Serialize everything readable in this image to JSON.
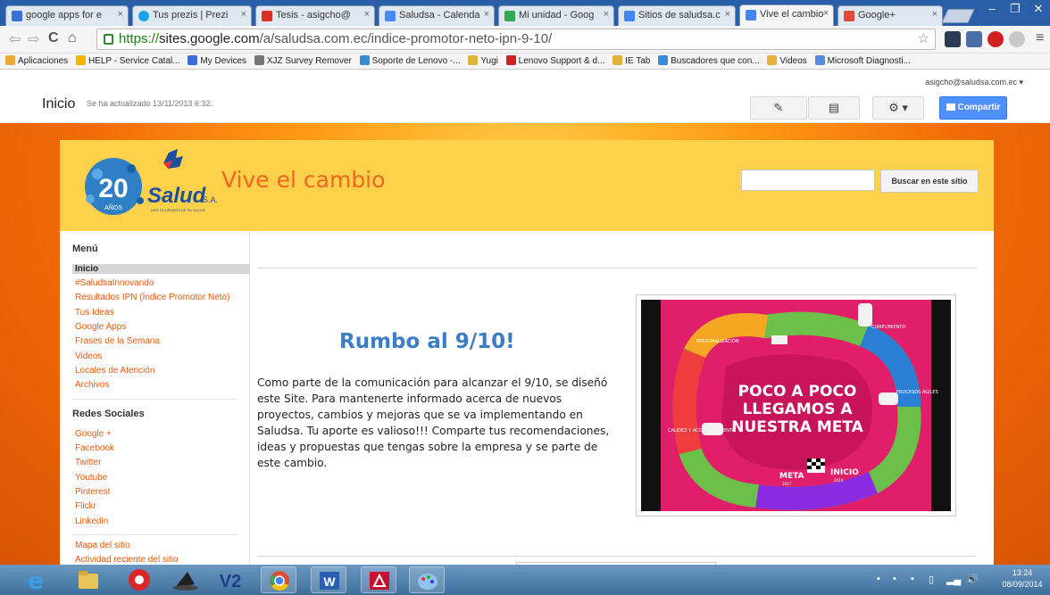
{
  "browser": {
    "tabs": [
      {
        "label": "google apps for e",
        "favicon_color": "#3a6fd8"
      },
      {
        "label": "Tus prezis | Prezi",
        "favicon_color": "#1aa3e8"
      },
      {
        "label": "Tesis - asigcho@",
        "favicon_color": "#d93025"
      },
      {
        "label": "Saludsa - Calenda",
        "favicon_color": "#4a8af4"
      },
      {
        "label": "Mi unidad - Goog",
        "favicon_color": "#34a853"
      },
      {
        "label": "Sitios de saludsa.c",
        "favicon_color": "#4285f4"
      },
      {
        "label": "Vive el cambio",
        "favicon_color": "#4285f4"
      },
      {
        "label": "Google+",
        "favicon_color": "#dd4b39"
      }
    ],
    "tab_close_glyph": "×",
    "window_buttons": [
      "–",
      "❐",
      "✕"
    ],
    "url_scheme": "https://",
    "url_host": "sites.google.com",
    "url_path": "/a/saludsa.com.ec/indice-promotor-neto-ipn-9-10/",
    "star_glyph": "☆",
    "bookmarks": [
      {
        "label": "Aplicaciones",
        "icon_color": "#e8a93a"
      },
      {
        "label": "HELP - Service Catal...",
        "icon_color": "#f4b400"
      },
      {
        "label": "My Devices",
        "icon_color": "#3a6fd8"
      },
      {
        "label": "XJZ Survey Remover",
        "icon_color": "#777777"
      },
      {
        "label": "Soporte de Lenovo -...",
        "icon_color": "#3a8ad8"
      },
      {
        "label": "Yugi",
        "icon_color": "#e2b33a"
      },
      {
        "label": "Lenovo Support & d...",
        "icon_color": "#cc2222"
      },
      {
        "label": "IE Tab",
        "icon_color": "#e2b33a"
      },
      {
        "label": "Buscadores que con...",
        "icon_color": "#3a8ad8"
      },
      {
        "label": "Videos",
        "icon_color": "#e2b33a"
      },
      {
        "label": "Microsoft Diagnosti...",
        "icon_color": "#5a8ad8"
      }
    ]
  },
  "sites_header": {
    "page_title": "Inicio",
    "updated": "Se ha actualizado 13/11/2013 6:32.",
    "user": "asigcho@saludsa.com.ec",
    "user_menu_glyph": "▾",
    "edit_glyph": "✎",
    "new_page_glyph": "▤",
    "settings_glyph": "⚙ ▾",
    "share_label": "Compartir"
  },
  "site": {
    "logo_number": "20",
    "logo_years": "AÑOS",
    "logo_brand": "Salud",
    "logo_brand_suffix": "S.A.",
    "logo_tagline": "NOS OCUPAMOS DE SU SALUD",
    "title": "Vive el cambio",
    "search_placeholder": "",
    "search_button": "Buscar en este sitio",
    "sidebar": {
      "menu_heading": "Menú",
      "menu_items": [
        "Inicio",
        "#SaludsaInnovando",
        "Resultados IPN (Índice Promotor Neto)",
        "Tus Ideas",
        "Google Apps",
        "Frases de la Semana",
        "Videos",
        "Locales de Atención",
        "Archivos"
      ],
      "active_item": "Inicio",
      "social_heading": "Redes Sociales",
      "social_items": [
        "Google +",
        "Facebook",
        "Twitter",
        "Youtube",
        "Pinterest",
        "Flickr",
        "Linkedin"
      ],
      "footer_items": [
        "Mapa del sitio",
        "Actividad reciente del sitio"
      ]
    },
    "main": {
      "heading": "Rumbo al 9/10!",
      "body": "Como parte de la comunicación para alcanzar el 9/10, se diseñó este Site. Para mantenerte informado acerca de nuevos proyectos, cambios y mejoras que se va implementando en Saludsa. Tu aporte es valioso!!! Comparte tus recomendaciones, ideas y propuestas que tengas sobre la empresa y se parte de este cambio."
    },
    "infographic": {
      "line1": "POCO A POCO",
      "line2": "LLEGAMOS A",
      "line3": "NUESTRA META",
      "labels": [
        "PERSONALIZACIÓN",
        "CUMPLIMIENTO",
        "PROCESOS ÁGILES",
        "CALIDEZ Y ACOMPAÑAMIENTO",
        "META",
        "INICIO"
      ],
      "meta_year": "2017",
      "inicio_year": "2014"
    }
  },
  "taskbar": {
    "tray_glyphs": [
      "🔊"
    ],
    "time": "13:24",
    "date": "08/09/2014"
  }
}
